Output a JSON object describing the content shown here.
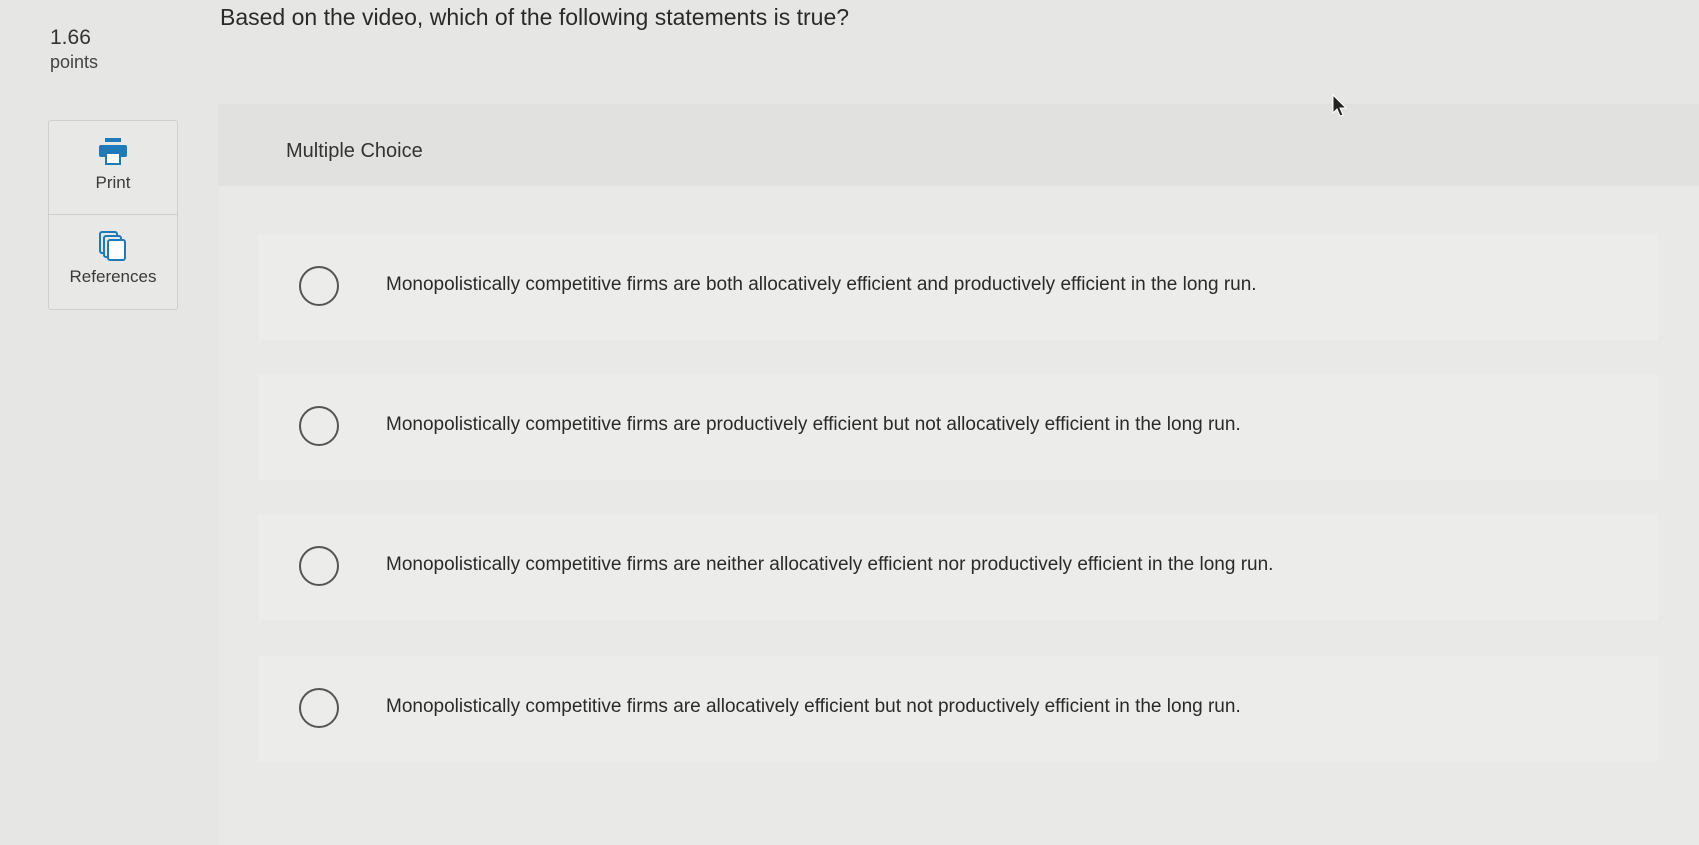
{
  "points": {
    "value": "1.66",
    "label": "points"
  },
  "question": {
    "text": "Based on the video, which of the following statements is true?"
  },
  "tools": [
    {
      "label": "Print",
      "icon": "printer-icon"
    },
    {
      "label": "References",
      "icon": "references-icon"
    }
  ],
  "section": {
    "title": "Multiple Choice"
  },
  "choices": [
    {
      "text": "Monopolistically competitive firms are both allocatively efficient and productively efficient in the long run."
    },
    {
      "text": "Monopolistically competitive firms are productively efficient but not allocatively efficient in the long run."
    },
    {
      "text": "Monopolistically competitive firms are neither allocatively efficient nor productively efficient in the long run."
    },
    {
      "text": "Monopolistically competitive firms are allocatively efficient but not productively efficient in the long run."
    }
  ],
  "colors": {
    "accent": "#1f7ab8"
  }
}
